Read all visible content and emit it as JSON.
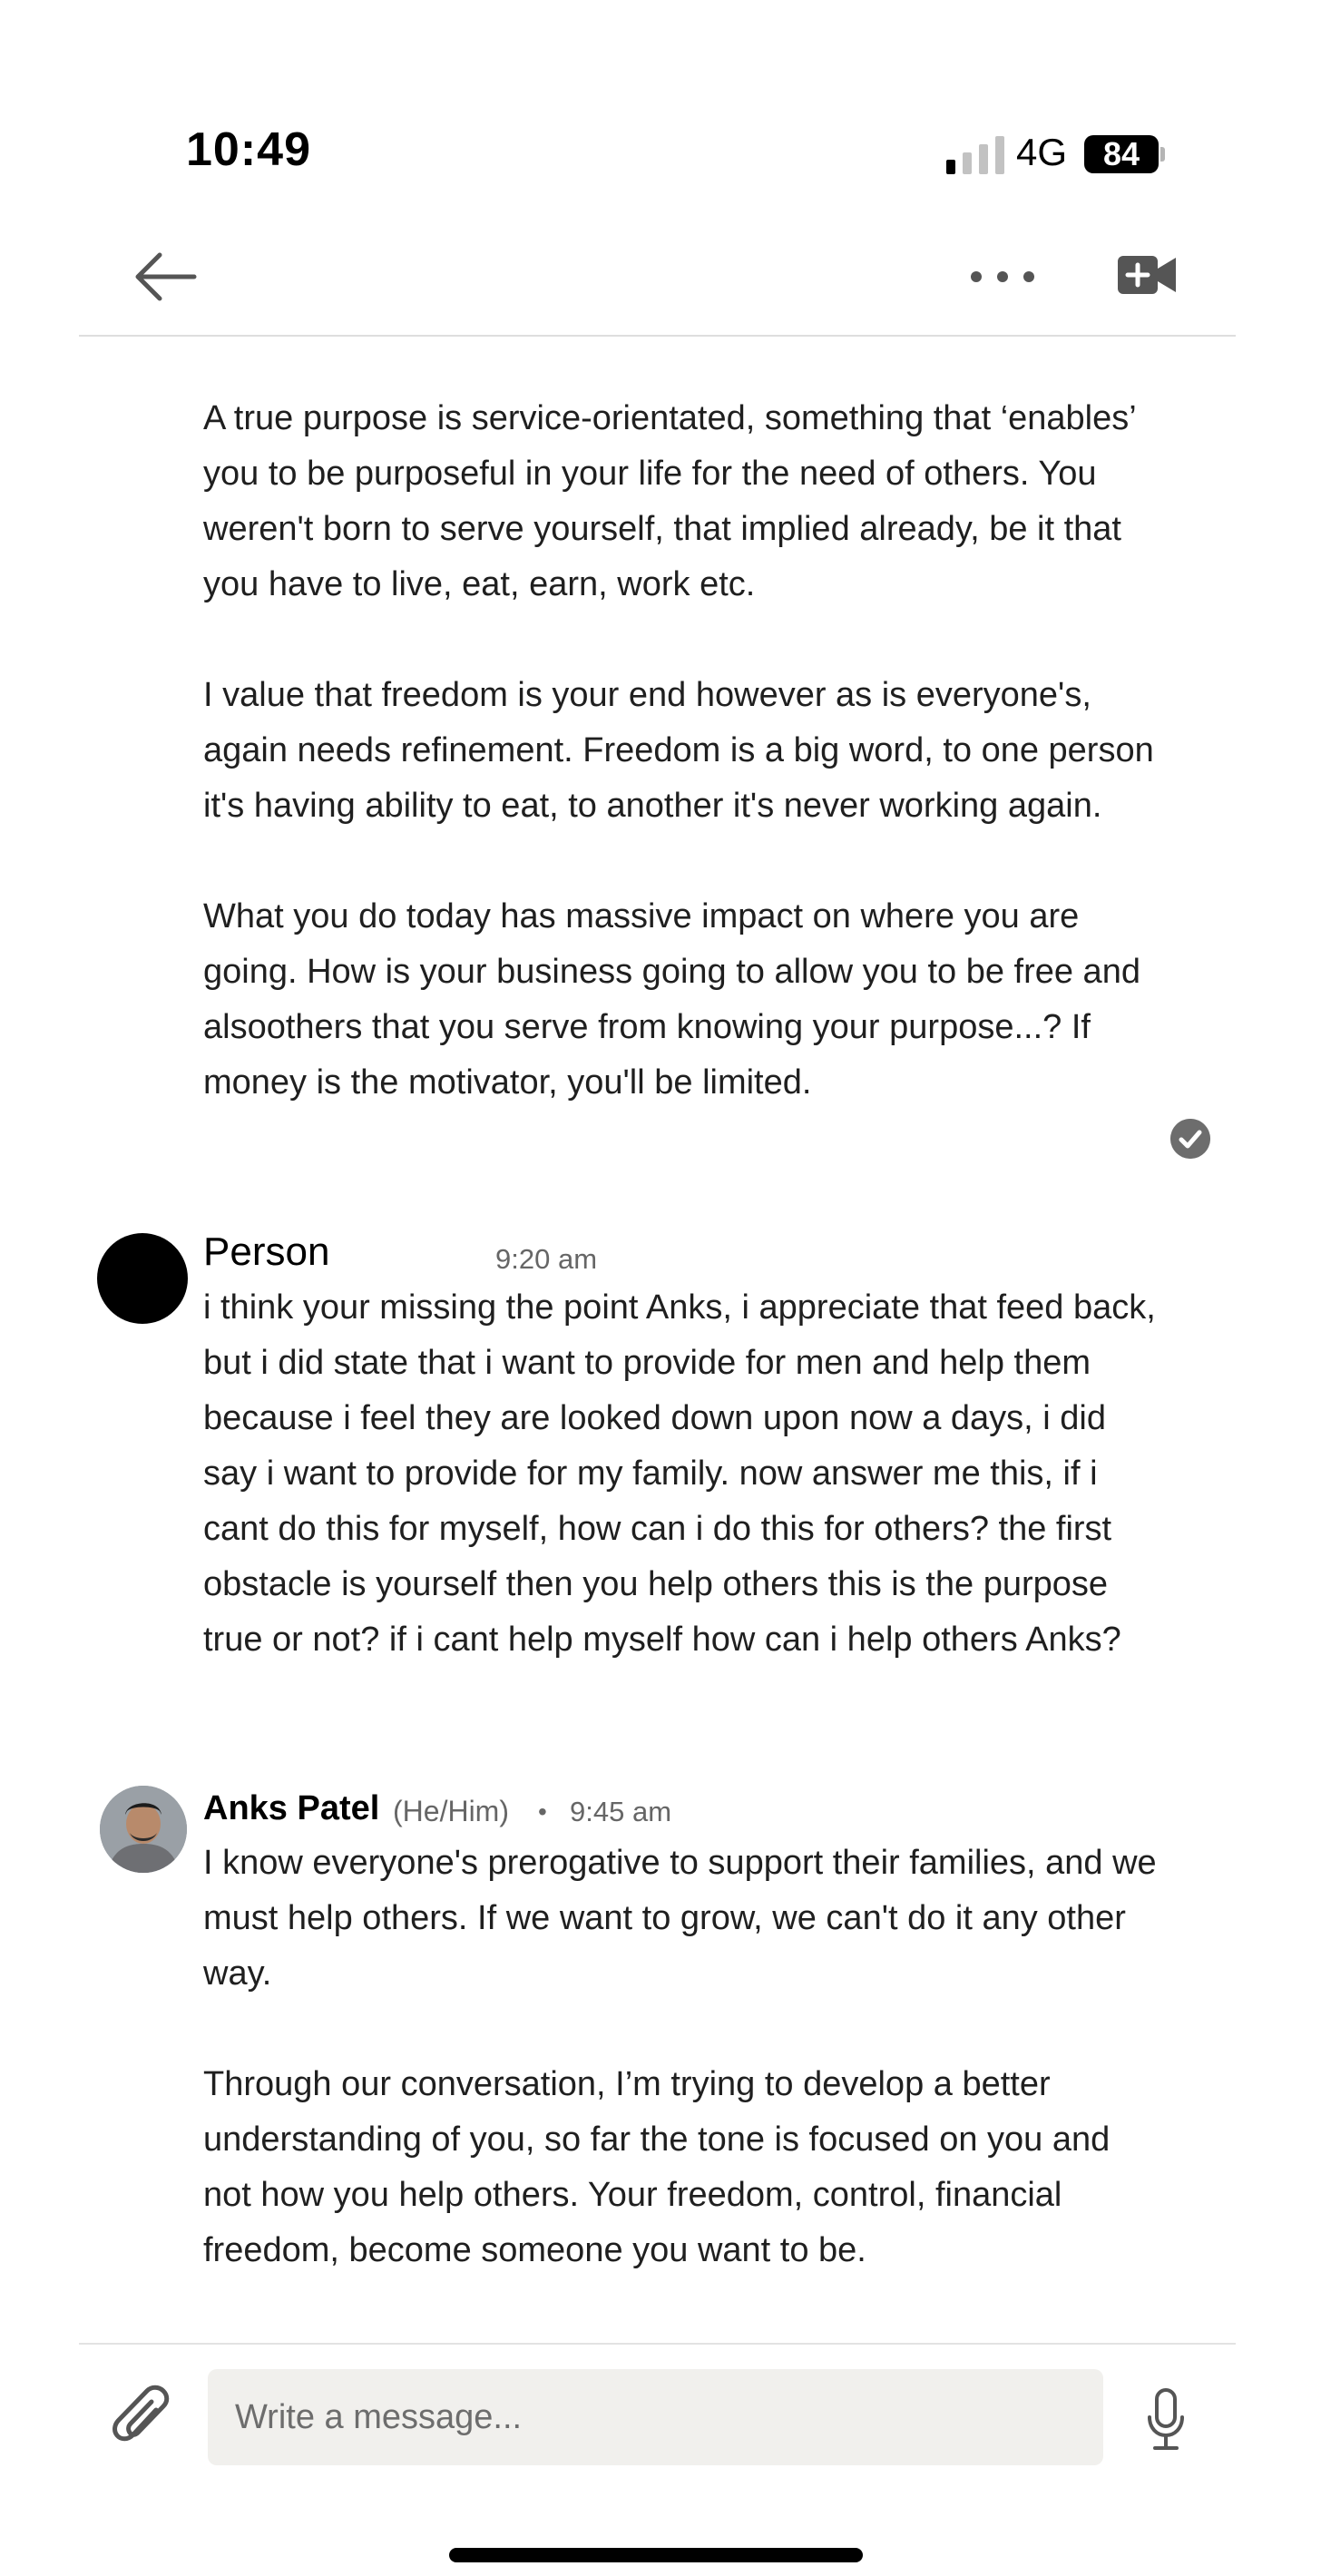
{
  "status_bar": {
    "time": "10:49",
    "network": "4G",
    "battery": "84"
  },
  "header": {
    "back_icon": "arrow-left-icon",
    "more_icon": "ellipsis-icon",
    "video_icon": "video-plus-icon"
  },
  "messages": [
    {
      "paragraphs": [
        "A true purpose is service-orientated, something that ‘enables’ you to be purposeful in your life for the need of others. You weren't born to serve yourself, that implied already, be it that you have to live, eat, earn, work etc.",
        "I value that freedom is your end however as is everyone's, again needs refinement. Freedom is a big word, to one person it's having ability to eat, to another it's never working again.",
        "What you do today has massive impact on where you are going. How is your business going to allow you to be free and alsoothers that you serve from knowing your purpose...? If money is the motivator, you'll be limited."
      ]
    },
    {
      "sender": "Person",
      "time": "9:20 am",
      "paragraphs": [
        "i think your missing the point Anks, i appreciate that feed back, but i did state that i want to provide for men and help them because i feel they are looked down upon now a days, i did say i want to provide for my family. now answer me this, if i cant do this for myself, how can i do this for others? the first obstacle is yourself then you help others this is the purpose true or not? if i cant help myself how can i help others Anks?"
      ]
    },
    {
      "sender": "Anks Patel",
      "pronouns": "(He/Him)",
      "separator": "•",
      "time": "9:45 am",
      "paragraphs": [
        "I know everyone's prerogative to support their families, and we must help others. If we want to grow, we can't do it any other way.",
        "Through our conversation, I’m trying to develop a better understanding of you, so far the tone is focused on you and not how you help others. Your freedom, control, financial freedom, become someone you want to be."
      ]
    }
  ],
  "composer": {
    "placeholder": "Write a message...",
    "attach_icon": "paperclip-icon",
    "mic_icon": "microphone-icon"
  }
}
